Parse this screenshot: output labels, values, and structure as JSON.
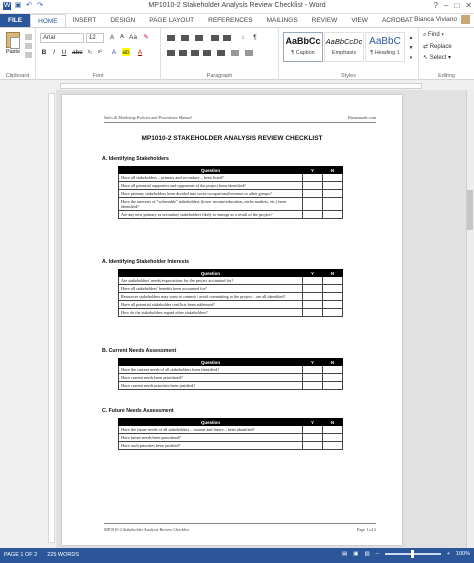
{
  "window": {
    "title": "MP1010-2 Stakeholder Analysis Review Checklist - Word"
  },
  "ribbon_tabs": [
    "FILE",
    "HOME",
    "INSERT",
    "DESIGN",
    "PAGE LAYOUT",
    "REFERENCES",
    "MAILINGS",
    "REVIEW",
    "VIEW",
    "ACROBAT"
  ],
  "user": {
    "name": "Bianca Viviano"
  },
  "font": {
    "name": "Arial",
    "size": "12"
  },
  "groups": {
    "clipboard": "Clipboard",
    "font": "Font",
    "paragraph": "Paragraph",
    "styles": "Styles",
    "editing": "Editing"
  },
  "paste_label": "Paste",
  "styles": [
    {
      "sample": "AaBbCc",
      "name": "¶ Caption"
    },
    {
      "sample": "AaBbCcDc",
      "name": "Emphasis"
    },
    {
      "sample": "AaBbC",
      "name": "¶ Heading 1"
    }
  ],
  "editing": {
    "find": "Find",
    "replace": "Replace",
    "select": "Select"
  },
  "doc": {
    "header_left": "Sales & Marketing Policies and Procedures Manual",
    "header_right": "Bizmanuals.com",
    "title": "MP1010-2 STAKEHOLDER ANALYSIS REVIEW CHECKLIST",
    "col_question": "Question",
    "col_y": "Y",
    "col_n": "N",
    "sections": [
      {
        "heading": "A.   Identifying Stakeholders",
        "rows": [
          "Have all stakeholders – primary and secondary – been listed?",
          "Have all potential supporters and opponents of the project been identified?",
          "Have primary stakeholders been divided into socio-occupational/revenue or other groups?",
          "Have the interests of \"vulnerable\" stakeholders (lower income/education, niche markets, etc.) been identified?",
          "Are any new primary or secondary stakeholders likely to emerge as a result of the project?"
        ]
      },
      {
        "heading": "A.   Identifying Stakeholder Interests",
        "rows": [
          "Are stakeholders' needs/expectations for the project accounted for?",
          "Have all stakeholders' benefits been accounted for?",
          "Resources stakeholders may want to commit / avoid committing to the project – are all identified?",
          "Have all potential stakeholder conflicts been addressed?",
          "How do the stakeholders regard other stakeholders?"
        ]
      },
      {
        "heading": "B.   Current Needs Assessment",
        "rows": [
          "Have the current needs of all stakeholders been identified?",
          "Have current needs been prioritized?",
          "Have current needs priorities been justified?"
        ]
      },
      {
        "heading": "C.   Future Needs Assessment",
        "rows": [
          "Have the future needs of all stakeholders – current and future – been identified?",
          "Have future needs been prioritized?",
          "Have such priorities been justified?"
        ]
      }
    ],
    "footer_left": "MP1010-2 Stakeholder Analysis Review Checklist",
    "footer_right": "Page 1 of 2"
  },
  "status": {
    "page": "PAGE 1 OF 2",
    "words": "225 WORDS",
    "zoom": "100%"
  },
  "colors": {
    "accent": "#2b579a"
  }
}
